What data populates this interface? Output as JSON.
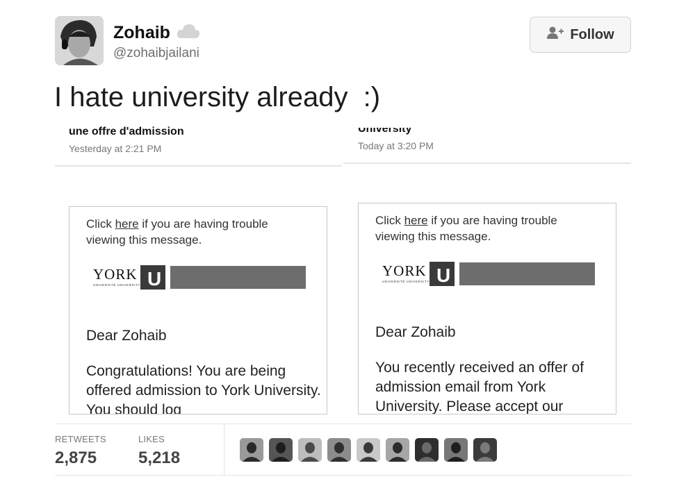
{
  "user": {
    "display_name": "Zohaib",
    "handle": "@zohaibjailani",
    "avatar_icon": "profile-photo",
    "badge_icon": "cloud-icon"
  },
  "follow_button": {
    "label": "Follow",
    "icon": "add-user-icon"
  },
  "tweet": {
    "text": "I hate university already  :)"
  },
  "emails": [
    {
      "subject": "une offre d'admission",
      "time": "Yesterday at 2:21 PM",
      "trouble_prefix": "Click ",
      "trouble_link": "here",
      "trouble_suffix": " if you are having trouble viewing this message.",
      "logo_text": "YORK",
      "logo_subtext": "UNIVERSITÉ UNIVERSITY",
      "logo_mark": "U",
      "greeting": "Dear Zohaib",
      "body": "Congratulations! You are being offered admission to York University. You should log"
    },
    {
      "subject": "University",
      "time": "Today at 3:20 PM",
      "trouble_prefix": "Click ",
      "trouble_link": "here",
      "trouble_suffix": " if you are having trouble viewing this message.",
      "logo_text": "YORK",
      "logo_subtext": "UNIVERSITÉ UNIVERSITY",
      "logo_mark": "U",
      "greeting": "Dear Zohaib",
      "body": "You recently received an offer of admission email from York University. Please accept our"
    }
  ],
  "stats": {
    "retweets_label": "RETWEETS",
    "retweets_value": "2,875",
    "likes_label": "LIKES",
    "likes_value": "5,218"
  },
  "likers": [
    {
      "shade": "#9a9a9a",
      "fg": "#2a2a2a"
    },
    {
      "shade": "#555555",
      "fg": "#1d1d1d"
    },
    {
      "shade": "#bdbdbd",
      "fg": "#4a4a4a"
    },
    {
      "shade": "#8c8c8c",
      "fg": "#2f2f2f"
    },
    {
      "shade": "#c9c9c9",
      "fg": "#3a3a3a"
    },
    {
      "shade": "#a6a6a6",
      "fg": "#2b2b2b"
    },
    {
      "shade": "#2e2e2e",
      "fg": "#6a6a6a"
    },
    {
      "shade": "#777777",
      "fg": "#1f1f1f"
    },
    {
      "shade": "#3b3b3b",
      "fg": "#7a7a7a"
    }
  ]
}
